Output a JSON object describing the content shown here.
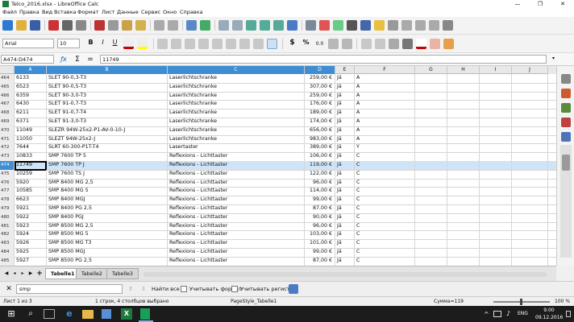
{
  "window": {
    "title": "Telco_2016.xlsx - LibreOffice Calc",
    "controls": [
      "—",
      "❐",
      "✕"
    ]
  },
  "menu": [
    "Файл",
    "Правка",
    "Вид",
    "Вставка",
    "Формат",
    "Лист",
    "Данные",
    "Сервис",
    "Окно",
    "Справка"
  ],
  "format_toolbar": {
    "font_name": "Arial",
    "font_size": "10",
    "currency": "$",
    "percent": "%",
    "decimal": "0.0"
  },
  "formula_bar": {
    "name_box": "A474:D474",
    "content": "11749",
    "sum_symbol": "Σ",
    "equal_symbol": "="
  },
  "columns": [
    "A",
    "B",
    "C",
    "D",
    "E",
    "F",
    "G",
    "H",
    "I",
    "J"
  ],
  "rows": [
    {
      "num": "464",
      "a": "6133",
      "b": "SLET 90-0,3-T3",
      "c": "Laserlichtschranke",
      "d": "259,00 €",
      "e": "Jä",
      "f": "A"
    },
    {
      "num": "465",
      "a": "6523",
      "b": "SLET 90-0,5-T3",
      "c": "Laserlichtschranke",
      "d": "307,00 €",
      "e": "Jä",
      "f": "A"
    },
    {
      "num": "466",
      "a": "6359",
      "b": "SLET 90-3,0-T3",
      "c": "Laserlichtschranke",
      "d": "259,00 €",
      "e": "Jä",
      "f": "A"
    },
    {
      "num": "467",
      "a": "6430",
      "b": "SLET 91-0,7-T3",
      "c": "Laserlichtschranke",
      "d": "176,00 €",
      "e": "Jä",
      "f": "A"
    },
    {
      "num": "468",
      "a": "6211",
      "b": "SLET 91-0,7-T4",
      "c": "Laserlichtschranke",
      "d": "189,00 €",
      "e": "Jä",
      "f": "A"
    },
    {
      "num": "469",
      "a": "6371",
      "b": "SLET 91-3,0-T3",
      "c": "Laserlichtschranke",
      "d": "174,00 €",
      "e": "Jä",
      "f": "A"
    },
    {
      "num": "470",
      "a": "11049",
      "b": "SLEZR 94W-25x2-P1-AV-0-10-J",
      "c": "Laserlichtschranke",
      "d": "656,00 €",
      "e": "Jä",
      "f": "A"
    },
    {
      "num": "471",
      "a": "11050",
      "b": "SLEZT 94W-25x2-J",
      "c": "Laserlichtschranke",
      "d": "983,00 €",
      "e": "Jä",
      "f": "A"
    },
    {
      "num": "472",
      "a": "7644",
      "b": "SLRT 60-300-P1T-T4",
      "c": "Lasertaster",
      "d": "389,00 €",
      "e": "Jä",
      "f": "Y"
    },
    {
      "num": "473",
      "a": "10833",
      "b": "SMP 7600 TP 5",
      "c": "Reflexions - Lichttaster",
      "d": "106,00 €",
      "e": "Jä",
      "f": "C"
    },
    {
      "num": "474",
      "a": "11749",
      "b": "SMP 7600 TP J",
      "c": "Reflexions - Lichttaster",
      "d": "119,00 €",
      "e": "Jä",
      "f": "C"
    },
    {
      "num": "475",
      "a": "10259",
      "b": "SMP 7600 TS J",
      "c": "Reflexions - Lichttaster",
      "d": "122,00 €",
      "e": "Jä",
      "f": "C"
    },
    {
      "num": "476",
      "a": "5920",
      "b": "SMP 8400 MG 2,5",
      "c": "Reflexions - Lichttaster",
      "d": "96,00 €",
      "e": "Jä",
      "f": "C"
    },
    {
      "num": "477",
      "a": "10585",
      "b": "SMP 8400 MG 5",
      "c": "Reflexions - Lichttaster",
      "d": "114,00 €",
      "e": "Jä",
      "f": "C"
    },
    {
      "num": "478",
      "a": "6623",
      "b": "SMP 8400 MGJ",
      "c": "Reflexions - Lichttaster",
      "d": "99,00 €",
      "e": "Jä",
      "f": "C"
    },
    {
      "num": "479",
      "a": "5921",
      "b": "SMP 8400 PG 2,5",
      "c": "Reflexions - Lichttaster",
      "d": "87,00 €",
      "e": "Jä",
      "f": "C"
    },
    {
      "num": "480",
      "a": "5922",
      "b": "SMP 8400 PGJ",
      "c": "Reflexions - Lichttaster",
      "d": "90,00 €",
      "e": "Jä",
      "f": "C"
    },
    {
      "num": "481",
      "a": "5923",
      "b": "SMP 8500 MG 2,5",
      "c": "Reflexions - Lichttaster",
      "d": "96,00 €",
      "e": "Jä",
      "f": "C"
    },
    {
      "num": "482",
      "a": "5924",
      "b": "SMP 8500 MG 5",
      "c": "Reflexions - Lichttaster",
      "d": "103,00 €",
      "e": "Jä",
      "f": "C"
    },
    {
      "num": "483",
      "a": "5926",
      "b": "SMP 8500 MG T3",
      "c": "Reflexions - Lichttaster",
      "d": "101,00 €",
      "e": "Jä",
      "f": "C"
    },
    {
      "num": "484",
      "a": "5925",
      "b": "SMP 8500 MGJ",
      "c": "Reflexions - Lichttaster",
      "d": "99,00 €",
      "e": "Jä",
      "f": "C"
    },
    {
      "num": "485",
      "a": "5927",
      "b": "SMP 8500 PG 2,5",
      "c": "Reflexions - Lichttaster",
      "d": "87,00 €",
      "e": "Jä",
      "f": "C"
    }
  ],
  "sheet_tabs": [
    "Tabelle1",
    "Tabelle2",
    "Tabelle3"
  ],
  "add_sheet": "+",
  "find_bar": {
    "query": "smp",
    "find_all": "Найти все",
    "match_format": "Учитывать формат",
    "match_case": "Учитывать регистр"
  },
  "status_bar": {
    "sheet": "Лист 1 из 3",
    "selection": "1 строк, 4 столбцов выбрано",
    "page_style": "PageStyle_Tabelle1",
    "sum": "Сумма=119",
    "zoom": "100 %"
  },
  "taskbar": {
    "lang": "ENG",
    "time": "9:00",
    "date": "09.12.2016"
  },
  "colors": {
    "selection": "#3f8ed4",
    "row_highlight": "#cfe4f7",
    "calc_green": "#1e7a3c"
  }
}
